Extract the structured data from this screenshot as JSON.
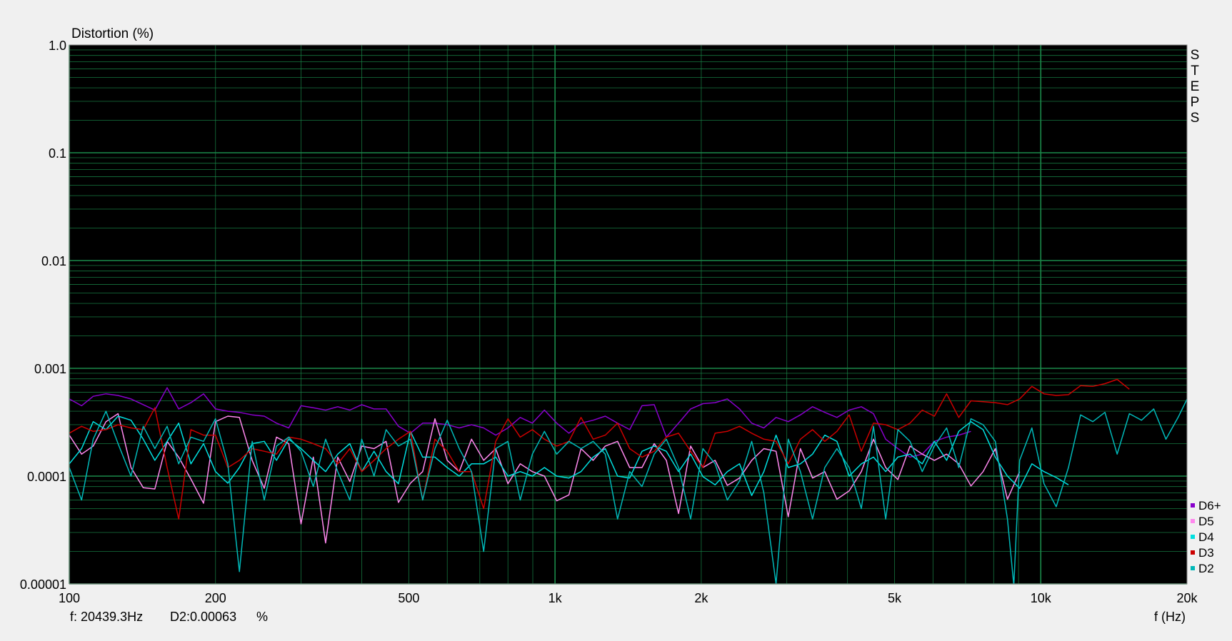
{
  "chart_data": {
    "type": "line",
    "title": "",
    "ylabel": "Distortion (%)",
    "xlabel": "f (Hz)",
    "x_scale": "log",
    "y_scale": "log",
    "xlim": [
      100,
      20000
    ],
    "ylim": [
      1e-05,
      1.0
    ],
    "grid": true,
    "background": "#000000",
    "grid_color": "#1a8a4a",
    "x_ticks": [
      {
        "value": 100,
        "label": "100"
      },
      {
        "value": 200,
        "label": "200"
      },
      {
        "value": 500,
        "label": "500"
      },
      {
        "value": 1000,
        "label": "1k"
      },
      {
        "value": 2000,
        "label": "2k"
      },
      {
        "value": 5000,
        "label": "5k"
      },
      {
        "value": 10000,
        "label": "10k"
      },
      {
        "value": 20000,
        "label": "20k"
      }
    ],
    "y_ticks": [
      {
        "value": 1.0,
        "label": "1.0"
      },
      {
        "value": 0.1,
        "label": "0.1"
      },
      {
        "value": 0.01,
        "label": "0.01"
      },
      {
        "value": 0.001,
        "label": "0.001"
      },
      {
        "value": 0.0001,
        "label": "0.0001"
      },
      {
        "value": 1e-05,
        "label": "0.00001"
      }
    ],
    "side_label": "STEPS",
    "readout": {
      "freq": "f: 20439.3Hz",
      "value": "D2:0.00063",
      "unit": "%"
    },
    "legend_position": "right-bottom",
    "series": [
      {
        "name": "D6+",
        "color": "#8800cc",
        "x": [
          100,
          106,
          112,
          119,
          126,
          134,
          142,
          150,
          159,
          168,
          178,
          189,
          200,
          212,
          224,
          238,
          252,
          267,
          283,
          300,
          318,
          337,
          357,
          378,
          400,
          424,
          449,
          476,
          504,
          534,
          566,
          600,
          635,
          673,
          713,
          755,
          800,
          848,
          898,
          951,
          1008,
          1068,
          1131,
          1198,
          1269,
          1345,
          1425,
          1510,
          1600,
          1695,
          1796,
          1902,
          2016,
          2136,
          2263,
          2398,
          2540,
          2691,
          2851,
          3021,
          3200,
          3390,
          3592,
          3805,
          4032,
          4271,
          4525,
          4794,
          5079,
          5381,
          5701,
          6040,
          6399,
          6779,
          7182
        ],
        "y": [
          0.00052,
          0.00045,
          0.00055,
          0.00058,
          0.00056,
          0.00052,
          0.00046,
          0.00041,
          0.00066,
          0.00042,
          0.00048,
          0.00058,
          0.00042,
          0.0004,
          0.00039,
          0.00037,
          0.00036,
          0.00031,
          0.00028,
          0.00045,
          0.00043,
          0.00041,
          0.00044,
          0.00041,
          0.00046,
          0.00042,
          0.00042,
          0.00029,
          0.00025,
          0.00031,
          0.00031,
          0.0003,
          0.00028,
          0.0003,
          0.00028,
          0.00024,
          0.00028,
          0.00035,
          0.00031,
          0.00041,
          0.00031,
          0.00025,
          0.00031,
          0.00033,
          0.00036,
          0.00031,
          0.00027,
          0.00045,
          0.00046,
          0.00023,
          0.00031,
          0.00042,
          0.00047,
          0.00048,
          0.00052,
          0.00042,
          0.00031,
          0.00028,
          0.00035,
          0.00032,
          0.00037,
          0.00044,
          0.00039,
          0.00035,
          0.00041,
          0.00044,
          0.00038,
          0.00022,
          0.00018,
          0.00015,
          0.00016,
          0.00021,
          0.00023,
          0.00024,
          0.00026
        ]
      },
      {
        "name": "D5",
        "color": "#ff88ee",
        "x": [
          100,
          106,
          112,
          119,
          126,
          134,
          142,
          150,
          159,
          168,
          178,
          189,
          200,
          212,
          224,
          238,
          252,
          267,
          283,
          300,
          318,
          337,
          357,
          378,
          400,
          424,
          449,
          476,
          504,
          534,
          566,
          600,
          635,
          673,
          713,
          755,
          800,
          848,
          898,
          951,
          1008,
          1068,
          1131,
          1198,
          1269,
          1345,
          1425,
          1510,
          1600,
          1695,
          1796,
          1902,
          2016,
          2136,
          2263,
          2398,
          2540,
          2691,
          2851,
          3021,
          3200,
          3390,
          3592,
          3805,
          4032,
          4271,
          4525,
          4794,
          5079,
          5381,
          5701,
          6040,
          6399,
          6779,
          7182,
          7609,
          8061,
          8540,
          9048
        ],
        "y": [
          0.00024,
          0.00016,
          0.00019,
          0.00032,
          0.00038,
          0.00012,
          7.8e-05,
          7.6e-05,
          0.00021,
          0.00015,
          9.4e-05,
          5.6e-05,
          0.00032,
          0.00036,
          0.00035,
          0.00014,
          7.7e-05,
          0.00023,
          0.0002,
          3.6e-05,
          0.00015,
          2.4e-05,
          0.00015,
          8.9e-05,
          0.00019,
          0.00018,
          0.00021,
          5.7e-05,
          8.6e-05,
          0.00011,
          0.00034,
          0.00014,
          0.00011,
          0.00022,
          0.00014,
          0.00018,
          8.5e-05,
          0.00013,
          0.00011,
          0.0001,
          5.9e-05,
          6.7e-05,
          0.00018,
          0.00014,
          0.00019,
          0.00021,
          0.00012,
          0.00012,
          0.0002,
          0.00014,
          4.5e-05,
          0.00019,
          0.00012,
          0.00014,
          8.2e-05,
          9.6e-05,
          0.00014,
          0.00018,
          0.00017,
          4.2e-05,
          0.00018,
          9.6e-05,
          0.00011,
          6.1e-05,
          7.3e-05,
          0.00011,
          0.00022,
          0.00012,
          9.3e-05,
          0.00019,
          0.00016,
          0.00014,
          0.00016,
          0.00013,
          8.1e-05,
          0.00011,
          0.00018,
          6.1e-05,
          0.00011
        ]
      },
      {
        "name": "D4",
        "color": "#00e0e0",
        "x": [
          100,
          106,
          112,
          119,
          126,
          134,
          142,
          150,
          159,
          168,
          178,
          189,
          200,
          212,
          224,
          238,
          252,
          267,
          283,
          300,
          318,
          337,
          357,
          378,
          400,
          424,
          449,
          476,
          504,
          534,
          566,
          600,
          635,
          673,
          713,
          755,
          800,
          848,
          898,
          951,
          1008,
          1068,
          1131,
          1198,
          1269,
          1345,
          1425,
          1510,
          1600,
          1695,
          1796,
          1902,
          2016,
          2136,
          2263,
          2398,
          2540,
          2691,
          2851,
          3021,
          3200,
          3390,
          3592,
          3805,
          4032,
          4271,
          4525,
          4794,
          5079,
          5381,
          5701,
          6040,
          6399,
          6779,
          7182,
          7609,
          8061,
          8540,
          9048,
          9586,
          10156,
          10760,
          11400
        ],
        "y": [
          0.00013,
          0.00018,
          0.00032,
          0.00027,
          0.00036,
          0.00033,
          0.00022,
          0.00014,
          0.00021,
          0.00031,
          0.00013,
          0.0002,
          0.00011,
          8.6e-05,
          0.00012,
          0.0002,
          0.00021,
          0.00014,
          0.00022,
          0.00018,
          0.00014,
          0.00011,
          0.00016,
          0.0002,
          0.00011,
          0.00017,
          0.00011,
          8.5e-05,
          0.00026,
          0.00015,
          0.00015,
          0.00012,
          0.0001,
          0.00013,
          0.00013,
          0.00015,
          0.0001,
          0.00011,
          0.0001,
          0.00012,
          0.0001,
          9.6e-05,
          0.00011,
          0.00015,
          0.00018,
          0.0001,
          9.6e-05,
          0.00017,
          0.00019,
          0.00017,
          0.00011,
          0.00016,
          9.9e-05,
          8.3e-05,
          0.00011,
          0.00013,
          6.6e-05,
          0.00011,
          0.00024,
          0.00012,
          0.00013,
          0.00016,
          0.00024,
          0.00021,
          0.0001,
          0.00013,
          0.00015,
          0.00011,
          0.00015,
          0.00016,
          0.00013,
          0.00021,
          0.00014,
          0.00026,
          0.00032,
          0.00027,
          0.00015,
          0.0001,
          7.7e-05,
          0.00013,
          0.00011,
          9.7e-05,
          8.3e-05
        ]
      },
      {
        "name": "D3",
        "color": "#cc0000",
        "x": [
          100,
          106,
          112,
          119,
          126,
          134,
          142,
          150,
          159,
          168,
          178,
          189,
          200,
          212,
          224,
          238,
          252,
          267,
          283,
          300,
          318,
          337,
          357,
          378,
          400,
          424,
          449,
          476,
          504,
          534,
          566,
          600,
          635,
          673,
          713,
          755,
          800,
          848,
          898,
          951,
          1008,
          1068,
          1131,
          1198,
          1269,
          1345,
          1425,
          1510,
          1600,
          1695,
          1796,
          1902,
          2016,
          2136,
          2263,
          2398,
          2540,
          2691,
          2851,
          3021,
          3200,
          3390,
          3592,
          3805,
          4032,
          4271,
          4525,
          4794,
          5079,
          5381,
          5701,
          6040,
          6399,
          6779,
          7182,
          7609,
          8061,
          8540,
          9048,
          9586,
          10156,
          10760,
          11400,
          12078,
          12796,
          13557,
          14363,
          15217
        ],
        "y": [
          0.00025,
          0.00029,
          0.00026,
          0.00027,
          0.0003,
          0.00028,
          0.00027,
          0.00043,
          0.00012,
          4e-05,
          0.00027,
          0.00024,
          0.00024,
          0.00012,
          0.00014,
          0.00018,
          0.00017,
          0.00016,
          0.00023,
          0.00022,
          0.0002,
          0.00018,
          0.00013,
          0.00018,
          0.00011,
          0.00014,
          0.00018,
          0.00022,
          0.00026,
          6e-05,
          0.00022,
          0.00017,
          0.00011,
          0.00011,
          5e-05,
          0.00021,
          0.00034,
          0.00023,
          0.00027,
          0.00022,
          0.00019,
          0.00021,
          0.00035,
          0.00022,
          0.00024,
          0.00031,
          0.00018,
          0.00015,
          0.00017,
          0.00023,
          0.00025,
          0.00017,
          0.00012,
          0.00025,
          0.00026,
          0.00029,
          0.00025,
          0.00022,
          0.00021,
          0.00013,
          0.00022,
          0.00027,
          0.00021,
          0.00026,
          0.00037,
          0.00017,
          0.00031,
          0.0003,
          0.00027,
          0.00031,
          0.00041,
          0.00036,
          0.00058,
          0.00035,
          0.0005,
          0.00049,
          0.00048,
          0.00046,
          0.00052,
          0.00068,
          0.00058,
          0.00056,
          0.00057,
          0.00069,
          0.00068,
          0.00072,
          0.00079,
          0.00064
        ]
      },
      {
        "name": "D2",
        "color": "#00b8b8",
        "x": [
          100,
          106,
          112,
          119,
          126,
          134,
          142,
          150,
          159,
          168,
          178,
          189,
          200,
          212,
          224,
          238,
          252,
          267,
          283,
          300,
          318,
          337,
          357,
          378,
          400,
          424,
          449,
          476,
          504,
          534,
          566,
          600,
          635,
          673,
          713,
          755,
          800,
          848,
          898,
          951,
          1008,
          1068,
          1131,
          1198,
          1269,
          1345,
          1425,
          1510,
          1600,
          1695,
          1796,
          1902,
          2016,
          2136,
          2263,
          2398,
          2540,
          2691,
          2851,
          3021,
          3200,
          3390,
          3592,
          3805,
          4032,
          4271,
          4525,
          4794,
          5079,
          5381,
          5701,
          6040,
          6399,
          6779,
          7182,
          7609,
          8061,
          8540,
          8800,
          9048,
          9586,
          10156,
          10760,
          11400,
          12078,
          12796,
          13557,
          14363,
          15217,
          16122,
          17081,
          18097,
          19173,
          20439
        ],
        "y": [
          0.00012,
          6e-05,
          0.00022,
          0.0004,
          0.0002,
          0.0001,
          0.00029,
          0.00018,
          0.00029,
          0.00013,
          0.00023,
          0.00021,
          0.00034,
          0.00013,
          1.3e-05,
          0.00021,
          6e-05,
          0.00019,
          0.00023,
          0.00017,
          8e-05,
          0.00022,
          0.00011,
          6e-05,
          0.00022,
          0.0001,
          0.00027,
          0.00019,
          0.00022,
          6e-05,
          0.00018,
          0.00033,
          0.00018,
          0.00011,
          2e-05,
          0.00018,
          0.00021,
          6e-05,
          0.00016,
          0.00026,
          0.00016,
          0.00021,
          0.00018,
          0.00021,
          0.00016,
          4e-05,
          0.00011,
          8e-05,
          0.00016,
          0.00022,
          0.00012,
          4e-05,
          0.00018,
          0.00013,
          6e-05,
          9e-05,
          0.00021,
          7e-05,
          1e-05,
          0.00022,
          0.00011,
          4e-05,
          0.00012,
          0.00018,
          0.00012,
          5e-05,
          0.00029,
          4e-05,
          0.00027,
          0.00021,
          0.00011,
          0.00019,
          0.00028,
          0.00012,
          0.00034,
          0.0003,
          0.00021,
          4e-05,
          8e-06,
          0.00014,
          0.00028,
          8.5e-05,
          5.2e-05,
          0.00012,
          0.00037,
          0.00032,
          0.00039,
          0.00016,
          0.00038,
          0.00033,
          0.00042,
          0.00022,
          0.00035,
          0.00063
        ]
      }
    ]
  }
}
